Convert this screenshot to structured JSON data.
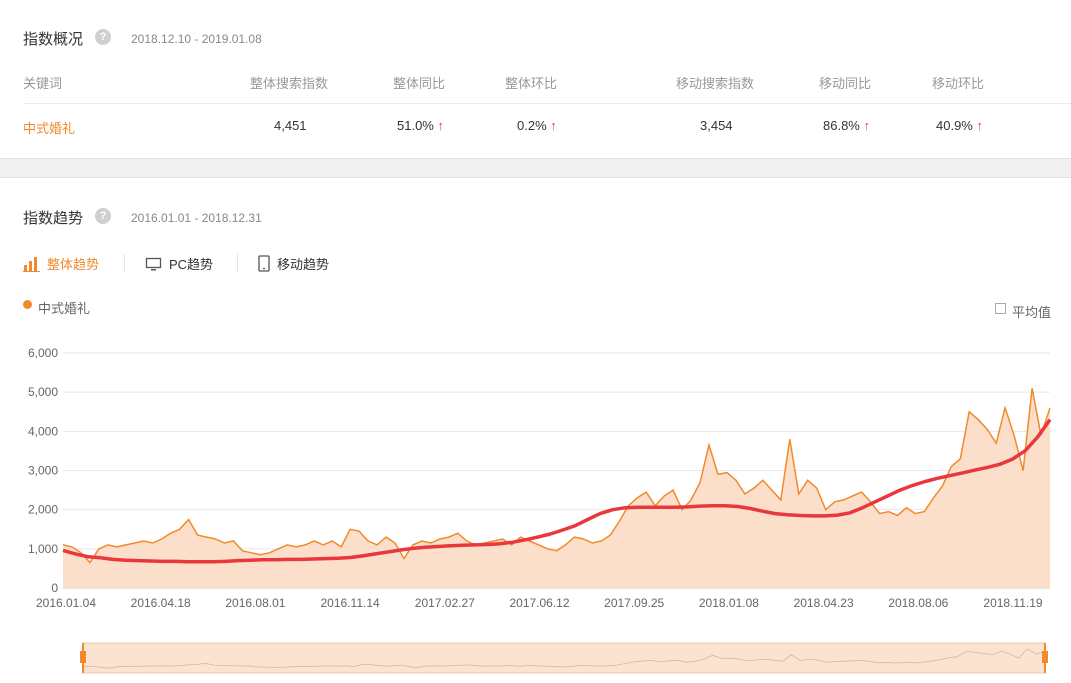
{
  "overview": {
    "title": "指数概况",
    "help": "?",
    "date_range": "2018.12.10 - 2019.01.08",
    "headers": [
      "关键词",
      "整体搜索指数",
      "整体同比",
      "整体环比",
      "移动搜索指数",
      "移动同比",
      "移动环比"
    ],
    "row": {
      "keyword": "中式婚礼",
      "overall_index": "4,451",
      "overall_yoy": "51.0%",
      "overall_mom": "0.2%",
      "mobile_index": "3,454",
      "mobile_yoy": "86.8%",
      "mobile_mom": "40.9%"
    },
    "arrow": "↑"
  },
  "trend": {
    "title": "指数趋势",
    "help": "?",
    "date_range": "2016.01.01 - 2018.12.31",
    "tabs": [
      "整体趋势",
      "PC趋势",
      "移动趋势"
    ],
    "legend": "中式婚礼",
    "average_label": "平均值"
  },
  "colors": {
    "accent": "#f08a2c",
    "area_fill": "#fcdcc4",
    "trend_line": "#e8383d",
    "up_arrow": "#ff3333"
  },
  "chart_data": {
    "type": "area",
    "x_ticks": [
      "2016.01.04",
      "2016.04.18",
      "2016.08.01",
      "2016.11.14",
      "2017.02.27",
      "2017.06.12",
      "2017.09.25",
      "2018.01.08",
      "2018.04.23",
      "2018.08.06",
      "2018.11.19"
    ],
    "ylim": [
      0,
      6000
    ],
    "y_ticks": [
      0,
      1000,
      2000,
      3000,
      4000,
      5000,
      6000
    ],
    "y_tick_labels": [
      "0",
      "1,000",
      "2,000",
      "3,000",
      "4,000",
      "5,000",
      "6,000"
    ],
    "grid": true,
    "series": [
      {
        "name": "中式婚礼",
        "values": [
          1100,
          1050,
          900,
          650,
          1000,
          1100,
          1050,
          1100,
          1150,
          1200,
          1150,
          1250,
          1400,
          1500,
          1750,
          1350,
          1300,
          1250,
          1150,
          1200,
          950,
          900,
          850,
          900,
          1000,
          1100,
          1050,
          1100,
          1200,
          1100,
          1200,
          1050,
          1500,
          1450,
          1200,
          1100,
          1300,
          1150,
          750,
          1100,
          1200,
          1150,
          1250,
          1300,
          1400,
          1200,
          1100,
          1150,
          1200,
          1250,
          1100,
          1300,
          1200,
          1100,
          1000,
          950,
          1100,
          1300,
          1250,
          1150,
          1200,
          1350,
          1700,
          2100,
          2300,
          2450,
          2100,
          2350,
          2500,
          2000,
          2250,
          2700,
          3650,
          2900,
          2950,
          2750,
          2400,
          2550,
          2750,
          2500,
          2250,
          3800,
          2400,
          2750,
          2550,
          2000,
          2200,
          2250,
          2350,
          2450,
          2200,
          1900,
          1950,
          1850,
          2050,
          1900,
          1950,
          2300,
          2600,
          3100,
          3300,
          4500,
          4300,
          4050,
          3700,
          4600,
          3900,
          3000,
          5100,
          3900,
          4600
        ],
        "trend_values": [
          960,
          870,
          800,
          770,
          730,
          710,
          700,
          690,
          680,
          680,
          670,
          670,
          670,
          680,
          700,
          710,
          720,
          720,
          730,
          730,
          740,
          750,
          760,
          780,
          820,
          870,
          920,
          970,
          1010,
          1040,
          1060,
          1080,
          1090,
          1100,
          1110,
          1130,
          1170,
          1230,
          1300,
          1380,
          1480,
          1590,
          1750,
          1900,
          2000,
          2050,
          2060,
          2060,
          2060,
          2060,
          2070,
          2090,
          2100,
          2100,
          2080,
          2030,
          1960,
          1900,
          1870,
          1850,
          1840,
          1840,
          1860,
          1920,
          2050,
          2200,
          2350,
          2500,
          2620,
          2720,
          2800,
          2870,
          2940,
          3010,
          3080,
          3160,
          3290,
          3500,
          3850,
          4300
        ]
      }
    ]
  }
}
